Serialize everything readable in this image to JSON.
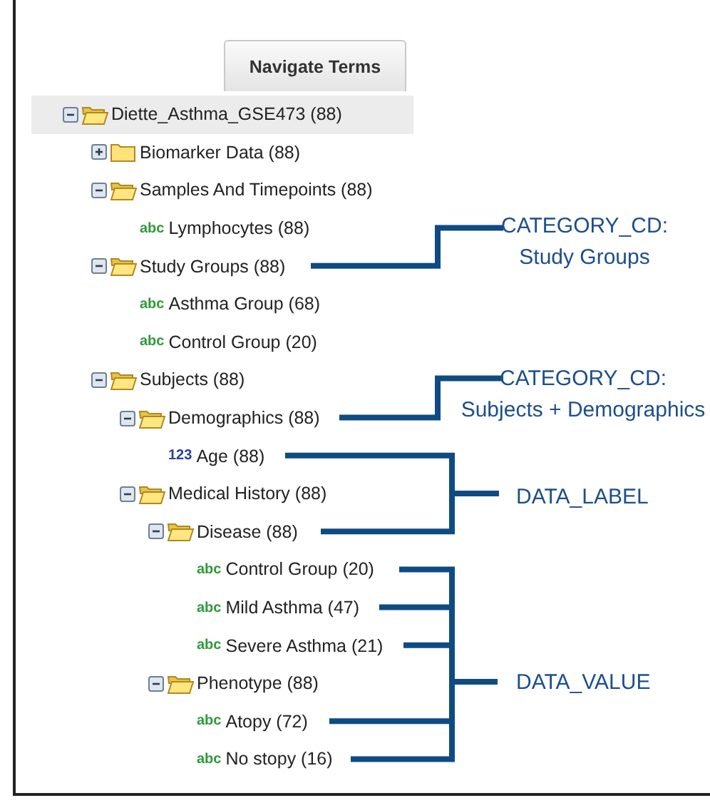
{
  "tab": {
    "label": "Navigate Terms",
    "selected": true
  },
  "tree": [
    {
      "label": "Diette_Asthma_GSE473 (88)",
      "kind": "folder",
      "expanded": true,
      "selected": true,
      "children": [
        {
          "label": "Biomarker Data (88)",
          "kind": "folder",
          "expanded": false,
          "selected": false
        },
        {
          "label": "Samples And Timepoints (88)",
          "kind": "folder",
          "expanded": true,
          "selected": false,
          "children": [
            {
              "label": "Lymphocytes (88)",
              "kind": "text",
              "type": "abc",
              "selected": false
            }
          ]
        },
        {
          "label": "Study Groups (88)",
          "kind": "folder",
          "expanded": true,
          "selected": false,
          "children": [
            {
              "label": "Asthma Group (68)",
              "kind": "text",
              "type": "abc",
              "selected": false
            },
            {
              "label": "Control Group (20)",
              "kind": "text",
              "type": "abc",
              "selected": false
            }
          ]
        },
        {
          "label": "Subjects (88)",
          "kind": "folder",
          "expanded": true,
          "selected": false,
          "children": [
            {
              "label": "Demographics (88)",
              "kind": "folder",
              "expanded": true,
              "selected": false,
              "children": [
                {
                  "label": "Age (88)",
                  "kind": "numeric",
                  "type": "123",
                  "selected": false
                }
              ]
            },
            {
              "label": "Medical History (88)",
              "kind": "folder",
              "expanded": true,
              "selected": false,
              "children": [
                {
                  "label": "Disease (88)",
                  "kind": "folder",
                  "expanded": true,
                  "selected": false,
                  "children": [
                    {
                      "label": "Control Group (20)",
                      "kind": "text",
                      "type": "abc",
                      "selected": false
                    },
                    {
                      "label": "Mild Asthma (47)",
                      "kind": "text",
                      "type": "abc",
                      "selected": false
                    },
                    {
                      "label": "Severe Asthma (21)",
                      "kind": "text",
                      "type": "abc",
                      "selected": false
                    }
                  ]
                },
                {
                  "label": "Phenotype (88)",
                  "kind": "folder",
                  "expanded": true,
                  "selected": false,
                  "children": [
                    {
                      "label": "Atopy (72)",
                      "kind": "text",
                      "type": "abc",
                      "selected": false
                    },
                    {
                      "label": "No stopy (16)",
                      "kind": "text",
                      "type": "abc",
                      "selected": false
                    }
                  ]
                }
              ]
            }
          ]
        }
      ]
    }
  ],
  "callouts": [
    {
      "lines": [
        "CATEGORY_CD:",
        "Study Groups"
      ]
    },
    {
      "lines": [
        "CATEGORY_CD:",
        "Subjects + Demographics"
      ]
    },
    {
      "lines": [
        "DATA_LABEL"
      ]
    },
    {
      "lines": [
        "DATA_VALUE"
      ]
    }
  ]
}
